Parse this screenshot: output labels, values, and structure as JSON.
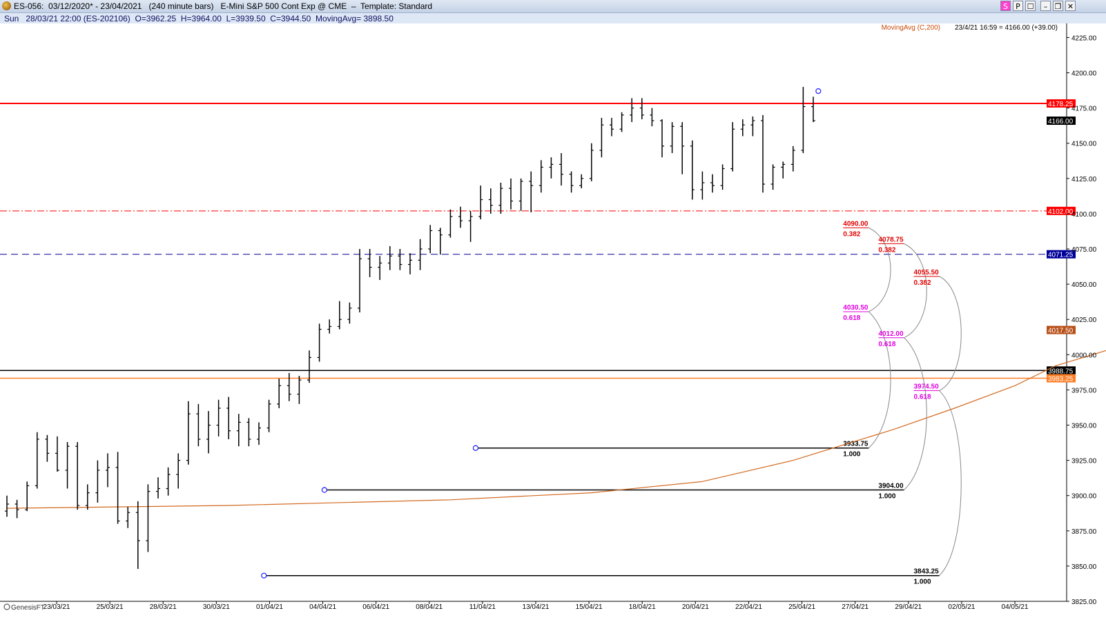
{
  "window": {
    "title": "ES-056:  03/12/2020* - 23/04/2021   (240 minute bars)   E-Mini S&P 500 Cont Exp @ CME  –  Template: Standard",
    "buttons": [
      "S",
      "P",
      "☐",
      "–",
      "❐",
      "✕"
    ]
  },
  "info_bar": "Sun   28/03/21 22:00 (ES-202106)  O=3962.25  H=3964.00  L=3939.50  C=3944.50  MovingAvg= 3898.50",
  "header_right": {
    "indicator": "MovingAvg (C,200)",
    "last": "23/4/21 16:59 = 4166.00 (+39.00)"
  },
  "logo": "GenesisFT",
  "colors": {
    "bars": "#000000",
    "moving_avg": "#d2691e",
    "resistance": "#ff0000",
    "support_dash": "#000099",
    "fib_upper": "#e00000",
    "fib_mid": "#e000e0",
    "fib_base": "#000000"
  },
  "chart_data": {
    "type": "ohlc",
    "ylim": [
      3825,
      4235
    ],
    "yticks": [
      "4225.00",
      "4200.00",
      "4175.00",
      "4150.00",
      "4125.00",
      "4100.00",
      "4075.00",
      "4050.00",
      "4025.00",
      "4000.00",
      "3975.00",
      "3950.00",
      "3925.00",
      "3900.00",
      "3875.00",
      "3850.00",
      "3825.00"
    ],
    "xticks": [
      "23/03/21",
      "25/03/21",
      "28/03/21",
      "30/03/21",
      "01/04/21",
      "04/04/21",
      "06/04/21",
      "08/04/21",
      "11/04/21",
      "13/04/21",
      "15/04/21",
      "18/04/21",
      "20/04/21",
      "22/04/21",
      "25/04/21",
      "27/04/21",
      "29/04/21",
      "02/05/21",
      "04/05/21"
    ],
    "bars": [
      [
        3889,
        3900,
        3885,
        3894
      ],
      [
        3894,
        3897,
        3884,
        3890
      ],
      [
        3890,
        3910,
        3889,
        3907
      ],
      [
        3907,
        3945,
        3905,
        3940
      ],
      [
        3940,
        3943,
        3924,
        3930
      ],
      [
        3930,
        3942,
        3917,
        3918
      ],
      [
        3918,
        3938,
        3905,
        3935
      ],
      [
        3935,
        3938,
        3890,
        3893
      ],
      [
        3893,
        3908,
        3890,
        3902
      ],
      [
        3902,
        3925,
        3895,
        3918
      ],
      [
        3918,
        3930,
        3906,
        3920
      ],
      [
        3920,
        3931,
        3880,
        3882
      ],
      [
        3882,
        3892,
        3877,
        3888
      ],
      [
        3888,
        3896,
        3848,
        3868
      ],
      [
        3868,
        3908,
        3860,
        3903
      ],
      [
        3903,
        3913,
        3898,
        3905
      ],
      [
        3905,
        3920,
        3900,
        3915
      ],
      [
        3915,
        3930,
        3905,
        3925
      ],
      [
        3925,
        3967,
        3922,
        3958
      ],
      [
        3958,
        3965,
        3935,
        3940
      ],
      [
        3940,
        3960,
        3930,
        3950
      ],
      [
        3950,
        3968,
        3942,
        3962
      ],
      [
        3962,
        3970,
        3940,
        3946
      ],
      [
        3946,
        3958,
        3935,
        3952
      ],
      [
        3952,
        3955,
        3935,
        3940
      ],
      [
        3940,
        3952,
        3936,
        3948
      ],
      [
        3948,
        3968,
        3945,
        3965
      ],
      [
        3965,
        3983,
        3962,
        3978
      ],
      [
        3978,
        3987,
        3967,
        3972
      ],
      [
        3972,
        3985,
        3965,
        3982
      ],
      [
        3982,
        4003,
        3980,
        3998
      ],
      [
        3998,
        4022,
        3995,
        4018
      ],
      [
        4018,
        4025,
        4015,
        4020
      ],
      [
        4020,
        4038,
        4018,
        4025
      ],
      [
        4025,
        4037,
        4022,
        4033
      ],
      [
        4033,
        4075,
        4030,
        4068
      ],
      [
        4068,
        4075,
        4055,
        4062
      ],
      [
        4062,
        4070,
        4053,
        4065
      ],
      [
        4065,
        4077,
        4060,
        4070
      ],
      [
        4070,
        4075,
        4060,
        4064
      ],
      [
        4064,
        4072,
        4057,
        4067
      ],
      [
        4067,
        4082,
        4060,
        4075
      ],
      [
        4075,
        4092,
        4072,
        4088
      ],
      [
        4088,
        4090,
        4071,
        4085
      ],
      [
        4085,
        4103,
        4083,
        4098
      ],
      [
        4098,
        4105,
        4090,
        4095
      ],
      [
        4095,
        4102,
        4080,
        4098
      ],
      [
        4098,
        4120,
        4096,
        4110
      ],
      [
        4110,
        4118,
        4100,
        4106
      ],
      [
        4106,
        4122,
        4100,
        4118
      ],
      [
        4118,
        4125,
        4103,
        4109
      ],
      [
        4109,
        4125,
        4102,
        4123
      ],
      [
        4123,
        4130,
        4101,
        4120
      ],
      [
        4120,
        4138,
        4115,
        4133
      ],
      [
        4133,
        4140,
        4125,
        4135
      ],
      [
        4135,
        4143,
        4120,
        4128
      ],
      [
        4128,
        4130,
        4115,
        4120
      ],
      [
        4120,
        4128,
        4118,
        4125
      ],
      [
        4125,
        4150,
        4123,
        4145
      ],
      [
        4145,
        4168,
        4140,
        4163
      ],
      [
        4163,
        4168,
        4155,
        4160
      ],
      [
        4160,
        4172,
        4158,
        4170
      ],
      [
        4170,
        4182,
        4165,
        4175
      ],
      [
        4175,
        4182,
        4167,
        4170
      ],
      [
        4170,
        4175,
        4162,
        4166
      ],
      [
        4166,
        4167,
        4140,
        4148
      ],
      [
        4148,
        4165,
        4143,
        4162
      ],
      [
        4162,
        4165,
        4128,
        4148
      ],
      [
        4148,
        4152,
        4110,
        4117
      ],
      [
        4117,
        4130,
        4110,
        4122
      ],
      [
        4122,
        4128,
        4115,
        4120
      ],
      [
        4120,
        4135,
        4117,
        4132
      ],
      [
        4132,
        4165,
        4130,
        4160
      ],
      [
        4160,
        4167,
        4155,
        4163
      ],
      [
        4163,
        4169,
        4155,
        4166
      ],
      [
        4166,
        4170,
        4115,
        4121
      ],
      [
        4121,
        4135,
        4117,
        4133
      ],
      [
        4133,
        4137,
        4125,
        4135
      ],
      [
        4135,
        4148,
        4130,
        4145
      ],
      [
        4145,
        4190,
        4143,
        4176
      ],
      [
        4176,
        4183,
        4165,
        4166
      ]
    ],
    "moving_avg": {
      "name": "MovingAvg (C,200)",
      "points": [
        [
          0,
          3891
        ],
        [
          22,
          3893
        ],
        [
          44,
          3897
        ],
        [
          58,
          3902
        ],
        [
          69,
          3910
        ],
        [
          78,
          3925
        ],
        [
          88,
          3947
        ],
        [
          94,
          3962
        ],
        [
          100,
          3978
        ],
        [
          104,
          3992
        ],
        [
          110,
          4005
        ],
        [
          116,
          4017.5
        ]
      ]
    },
    "horizontal_lines": [
      {
        "value": 4178.25,
        "label": "4178.25",
        "style": "solid-red"
      },
      {
        "value": 4102.0,
        "label": "4102.00",
        "style": "dashdot-red"
      },
      {
        "value": 4071.25,
        "label": "4071.25",
        "style": "dash-blue"
      },
      {
        "value": 3988.75,
        "label": "3988.75",
        "style": "solid-black"
      },
      {
        "value": 3983.25,
        "label": "3983.25",
        "style": "solid-orange"
      }
    ],
    "price_tags": [
      {
        "value": 4166.0,
        "label": "4166.00",
        "bg": "#000000",
        "fg": "#ffffff"
      },
      {
        "value": 4017.5,
        "label": "4017.50",
        "bg": "#b8501a",
        "fg": "#ffffff"
      }
    ],
    "fib_sets": [
      {
        "start_bar": 46.5,
        "end_bar": 85.5,
        "labels_bar": 85.5,
        "curve_bar": 88.4,
        "base": {
          "value": 3933.75,
          "label": "3933.75",
          "ratio": "1.000"
        },
        "upper": {
          "value": 4090.0,
          "label": "4090.00",
          "ratio": "0.382"
        },
        "mid": {
          "value": 4030.5,
          "label": "4030.50",
          "ratio": "0.618"
        }
      },
      {
        "start_bar": 31.5,
        "end_bar": 89.0,
        "labels_bar": 89.0,
        "curve_bar": 92.0,
        "base": {
          "value": 3904.0,
          "label": "3904.00",
          "ratio": "1.000"
        },
        "upper": {
          "value": 4078.75,
          "label": "4078.75",
          "ratio": "0.382"
        },
        "mid": {
          "value": 4012.0,
          "label": "4012.00",
          "ratio": "0.618"
        }
      },
      {
        "start_bar": 25.5,
        "end_bar": 92.5,
        "labels_bar": 92.5,
        "curve_bar": 95.4,
        "base": {
          "value": 3843.25,
          "label": "3843.25",
          "ratio": "1.000"
        },
        "upper": {
          "value": 4055.5,
          "label": "4055.50",
          "ratio": "0.382"
        },
        "mid": {
          "value": 3974.5,
          "label": "3974.50",
          "ratio": "0.618"
        }
      }
    ],
    "swing_markers": [
      {
        "bar": 80.5,
        "value": 4187
      },
      {
        "bar": 25.5,
        "value": 3843.25
      },
      {
        "bar": 31.5,
        "value": 3904
      },
      {
        "bar": 46.5,
        "value": 3933.75
      }
    ],
    "grid": false
  }
}
